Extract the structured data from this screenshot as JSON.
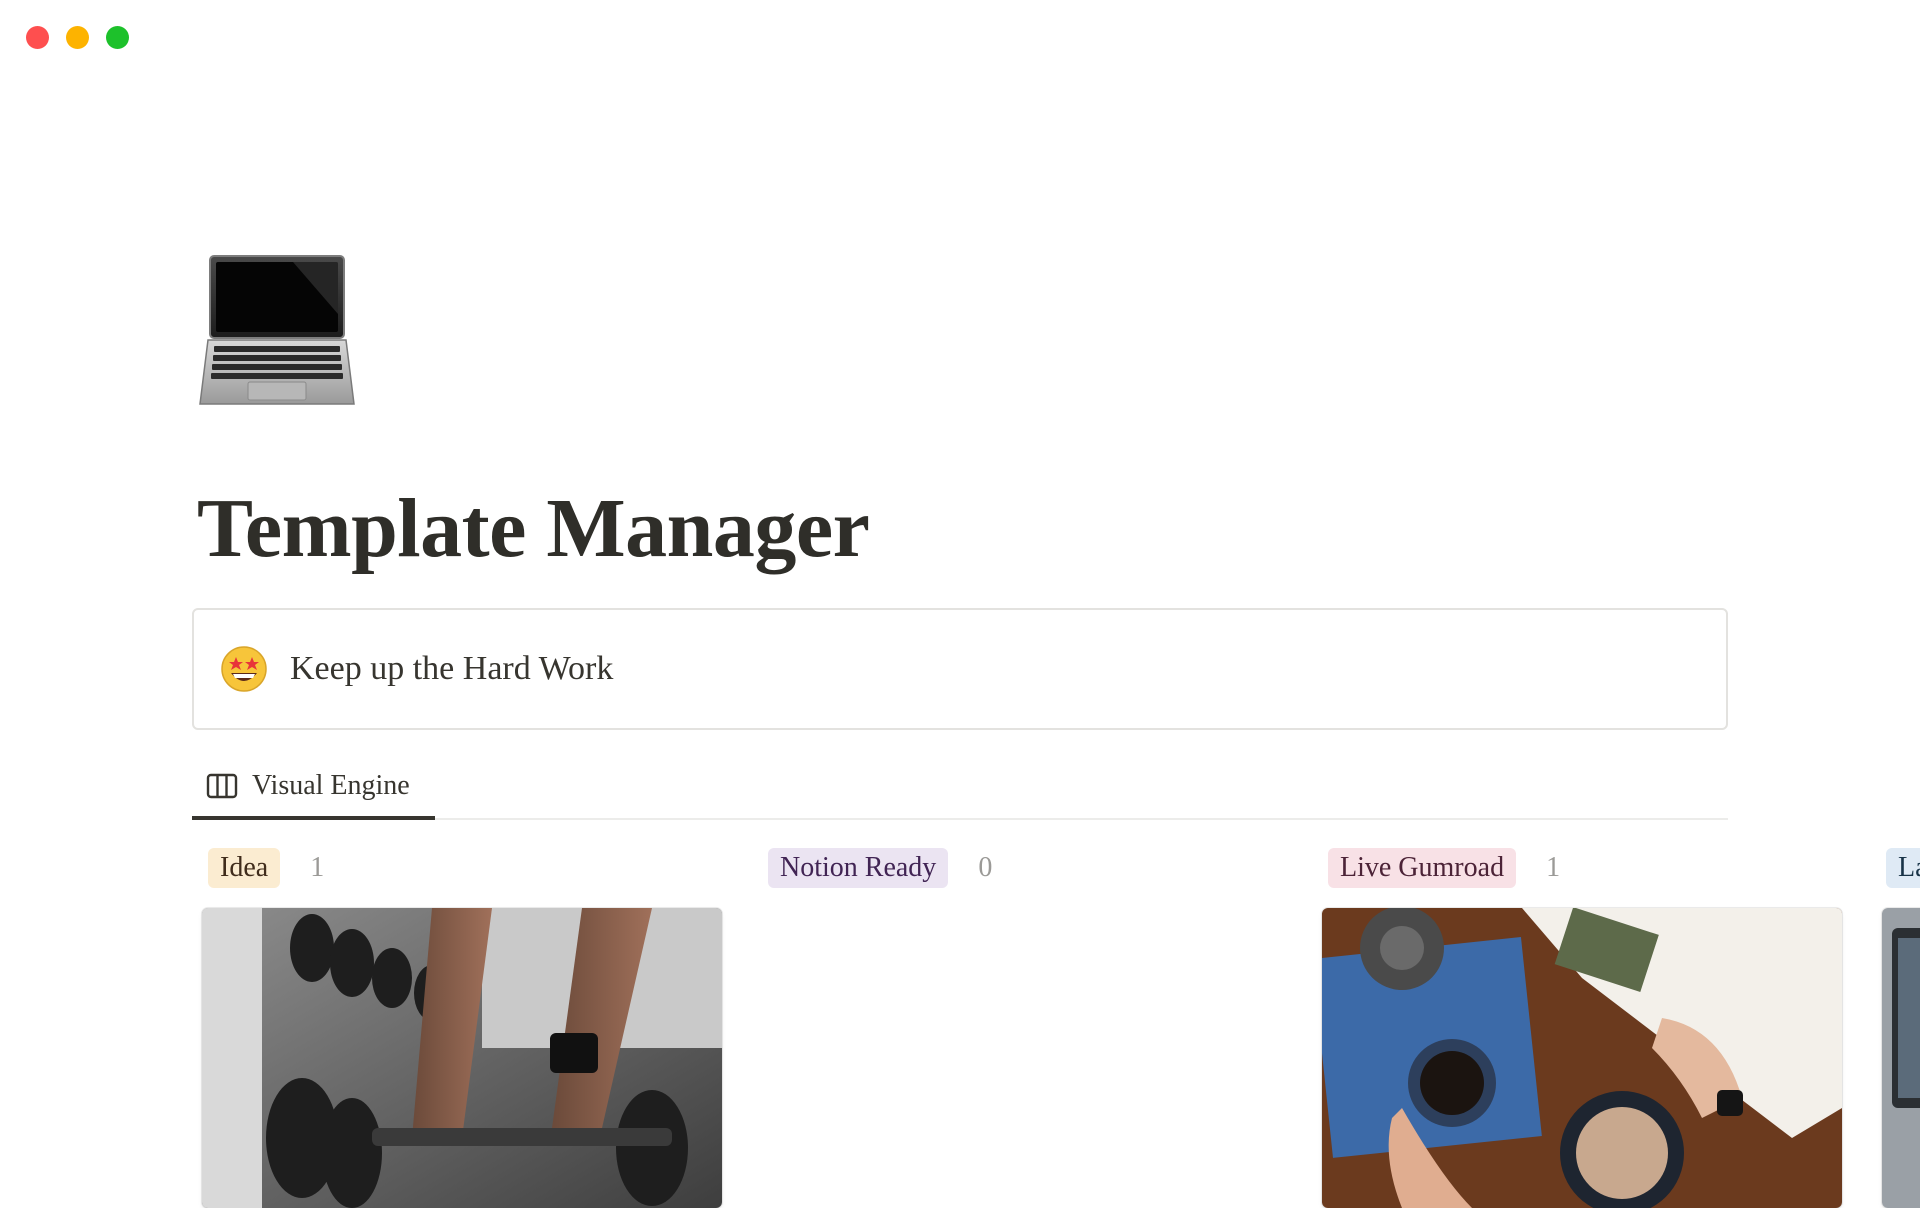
{
  "window": {
    "controls": [
      "close",
      "minimize",
      "maximize"
    ]
  },
  "page": {
    "icon": "laptop-icon",
    "title": "Template Manager"
  },
  "callout": {
    "icon": "star-struck-emoji-icon",
    "text": "Keep up the Hard Work"
  },
  "view_tabs": [
    {
      "icon": "board-view-icon",
      "label": "Visual Engine",
      "active": true
    }
  ],
  "board": {
    "groups": [
      {
        "label": "Idea",
        "count": "1",
        "color": "#fbecd1",
        "cards": [
          {
            "cover": "gym-dumbbell-photo"
          }
        ]
      },
      {
        "label": "Notion Ready",
        "count": "0",
        "color": "#ebe4f2",
        "cards": []
      },
      {
        "label": "Live Gumroad",
        "count": "1",
        "color": "#f8e1e6",
        "cards": [
          {
            "cover": "coffee-and-magazine-photo"
          }
        ]
      },
      {
        "label": "La",
        "count": "",
        "color": "#dfeaf5",
        "cards": [
          {
            "cover": "laptop-photo"
          }
        ]
      }
    ]
  }
}
